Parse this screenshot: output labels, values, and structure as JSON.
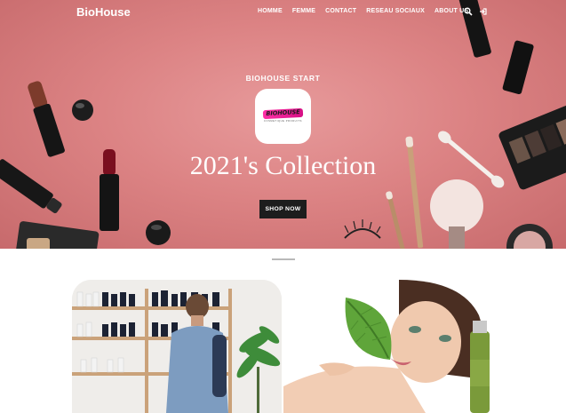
{
  "nav": {
    "brand": "BioHouse",
    "links": [
      "HOMME",
      "FEMME",
      "CONTACT",
      "RESEAU SOCIAUX",
      "ABOUT US"
    ],
    "icons": [
      "search-icon",
      "sign-in-icon"
    ]
  },
  "hero": {
    "subtitle": "BIOHOUSE START",
    "logo_text": "BIOHOUSE",
    "logo_tagline": "COSMETIQUE PRODUITS",
    "title": "2021's Collection",
    "cta_label": "SHOP NOW",
    "background_color": "#dc8384"
  },
  "colors": {
    "accent_pink": "#e0107d",
    "button_dark": "#1d1d1d"
  }
}
